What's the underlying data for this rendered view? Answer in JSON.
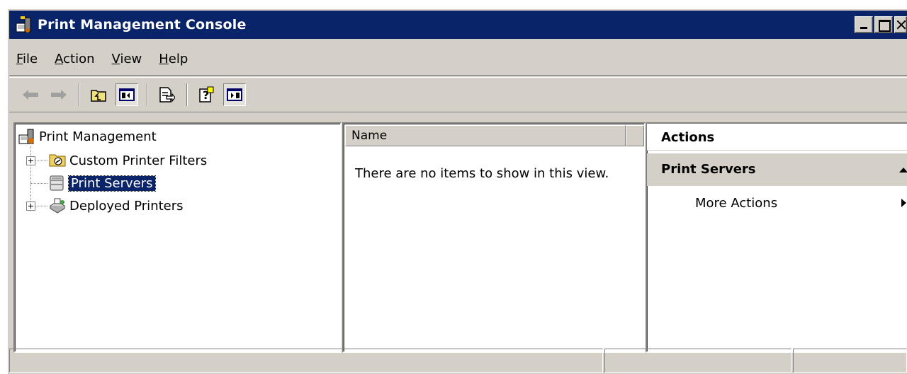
{
  "window": {
    "title": "Print Management Console"
  },
  "menu": {
    "items": [
      {
        "label_prefix": "",
        "label_u": "F",
        "label_rest": "ile"
      },
      {
        "label_prefix": "",
        "label_u": "A",
        "label_rest": "ction"
      },
      {
        "label_prefix": "",
        "label_u": "V",
        "label_rest": "iew"
      },
      {
        "label_prefix": "",
        "label_u": "H",
        "label_rest": "elp"
      }
    ]
  },
  "toolbar": {
    "buttons": [
      "back-arrow-icon",
      "forward-arrow-icon",
      "up-folder-icon",
      "show-hide-tree-icon",
      "export-list-icon",
      "help-icon",
      "show-hide-action-pane-icon"
    ]
  },
  "tree": {
    "root_label": "Print Management",
    "items": [
      {
        "label": "Custom Printer Filters",
        "expandable": true,
        "selected": false
      },
      {
        "label": "Print Servers",
        "expandable": false,
        "selected": true
      },
      {
        "label": "Deployed Printers",
        "expandable": true,
        "selected": false
      }
    ]
  },
  "list": {
    "column_name": "Name",
    "empty_message": "There are no items to show in this view."
  },
  "actions": {
    "header": "Actions",
    "section_title": "Print Servers",
    "items": [
      {
        "label": "More Actions"
      }
    ]
  },
  "colors": {
    "titlebar": "#0a246a",
    "chrome": "#d4d0c8",
    "selection": "#0a246a"
  }
}
